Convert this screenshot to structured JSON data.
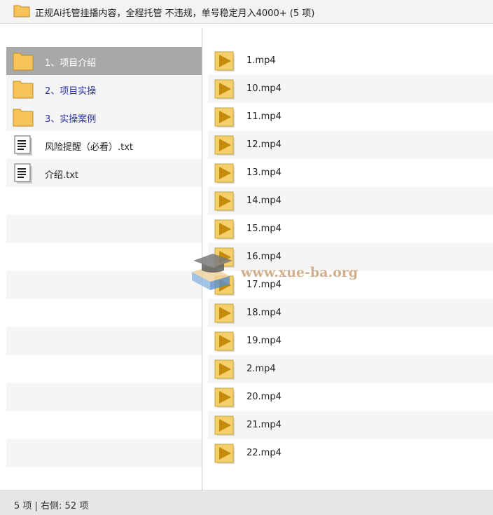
{
  "window": {
    "title": "正规Ai托管挂播内容，全程托管 不违规，单号稳定月入4000+ (5 项)"
  },
  "left_pane": {
    "items": [
      {
        "label": "1、项目介绍",
        "type": "folder",
        "selected": true
      },
      {
        "label": "2、项目实操",
        "type": "folder",
        "selected": false
      },
      {
        "label": "3、实操案例",
        "type": "folder",
        "selected": false
      },
      {
        "label": "风险提醒（必看）.txt",
        "type": "text-file",
        "selected": false
      },
      {
        "label": "介绍.txt",
        "type": "text-file",
        "selected": false
      }
    ]
  },
  "right_pane": {
    "items": [
      {
        "label": "1.mp4",
        "type": "video-file"
      },
      {
        "label": "10.mp4",
        "type": "video-file"
      },
      {
        "label": "11.mp4",
        "type": "video-file"
      },
      {
        "label": "12.mp4",
        "type": "video-file"
      },
      {
        "label": "13.mp4",
        "type": "video-file"
      },
      {
        "label": "14.mp4",
        "type": "video-file"
      },
      {
        "label": "15.mp4",
        "type": "video-file"
      },
      {
        "label": "16.mp4",
        "type": "video-file"
      },
      {
        "label": "17.mp4",
        "type": "video-file"
      },
      {
        "label": "18.mp4",
        "type": "video-file"
      },
      {
        "label": "19.mp4",
        "type": "video-file"
      },
      {
        "label": "2.mp4",
        "type": "video-file"
      },
      {
        "label": "20.mp4",
        "type": "video-file"
      },
      {
        "label": "21.mp4",
        "type": "video-file"
      },
      {
        "label": "22.mp4",
        "type": "video-file"
      }
    ]
  },
  "status": {
    "text": "5 项 | 右侧: 52 项"
  },
  "watermark": {
    "text": "www.xue-ba.org"
  },
  "colors": {
    "folder_fill": "#f8c45a",
    "folder_label": "#2a33a8",
    "selected_row": "#a8a8a8",
    "video_icon_bg": "#f5d06a",
    "video_play": "#c48a0a",
    "watermark": "#c9a27a"
  }
}
